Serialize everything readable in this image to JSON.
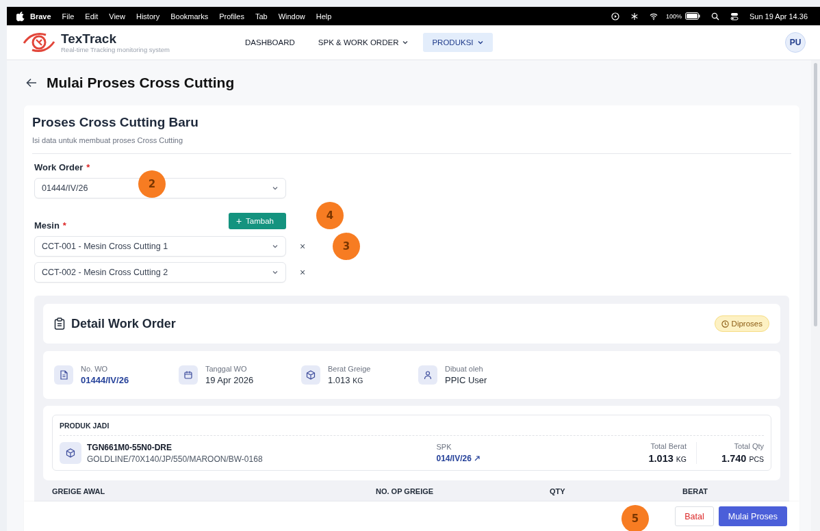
{
  "menubar": {
    "app": "Brave",
    "menus": [
      "File",
      "Edit",
      "View",
      "History",
      "Bookmarks",
      "Profiles",
      "Tab",
      "Window",
      "Help"
    ],
    "battery": "100%",
    "clock": "Sun 19 Apr 14.36"
  },
  "header": {
    "brand": "TexTrack",
    "tagline": "Real-time Tracking monitoring system",
    "avatar": "PU",
    "nav": [
      {
        "label": "DASHBOARD",
        "dropdown": false,
        "selected": false
      },
      {
        "label": "SPK & WORK ORDER",
        "dropdown": true,
        "selected": false
      },
      {
        "label": "PRODUKSI",
        "dropdown": true,
        "selected": true
      }
    ]
  },
  "page": {
    "title": "Mulai Proses Cross Cutting"
  },
  "form": {
    "title": "Proses Cross Cutting Baru",
    "subtitle": "Isi data untuk membuat proses Cross Cutting",
    "work_order": {
      "label": "Work Order",
      "required_mark": "*",
      "value": "01444/IV/26"
    },
    "mesin": {
      "label": "Mesin",
      "required_mark": "*",
      "add_icon": "+",
      "add_button": "Tambah",
      "machines": [
        {
          "value": "CCT-001 - Mesin Cross Cutting 1",
          "remove": "×"
        },
        {
          "value": "CCT-002 - Mesin Cross Cutting 2",
          "remove": "×"
        }
      ]
    }
  },
  "detail": {
    "title": "Detail Work Order",
    "status": "Diproses",
    "info": [
      {
        "kind": "document",
        "label": "No. WO",
        "value": "01444/IV/26",
        "link": true
      },
      {
        "kind": "calendar",
        "label": "Tanggal WO",
        "value": "19 Apr 2026",
        "link": false
      },
      {
        "kind": "box",
        "label": "Berat Greige",
        "value": "1.013",
        "unit": "KG",
        "link": false
      },
      {
        "kind": "user",
        "label": "Dibuat oleh",
        "value": "PPIC User",
        "link": false
      }
    ]
  },
  "produk": {
    "heading": "PRODUK JADI",
    "code": "TGN661M0-55N0-DRE",
    "description": "GOLDLINE/70X140/JP/550/MAROON/BW-0168",
    "spk_label": "SPK",
    "spk_value": "014/IV/26",
    "totals": [
      {
        "label": "Total Berat",
        "value": "1.013",
        "unit": "KG"
      },
      {
        "label": "Total Qty",
        "value": "1.740",
        "unit": "PCS"
      }
    ]
  },
  "greige_table": {
    "columns": [
      "GREIGE AWAL",
      "NO. OP GREIGE",
      "QTY",
      "BERAT"
    ]
  },
  "footer": {
    "buttons": [
      {
        "label": "Batal",
        "kind": "secondary"
      },
      {
        "label": "Mulai Proses",
        "kind": "primary"
      }
    ]
  },
  "annotations": [
    {
      "label": "2"
    },
    {
      "label": "3"
    },
    {
      "label": "4"
    },
    {
      "label": "5"
    }
  ]
}
